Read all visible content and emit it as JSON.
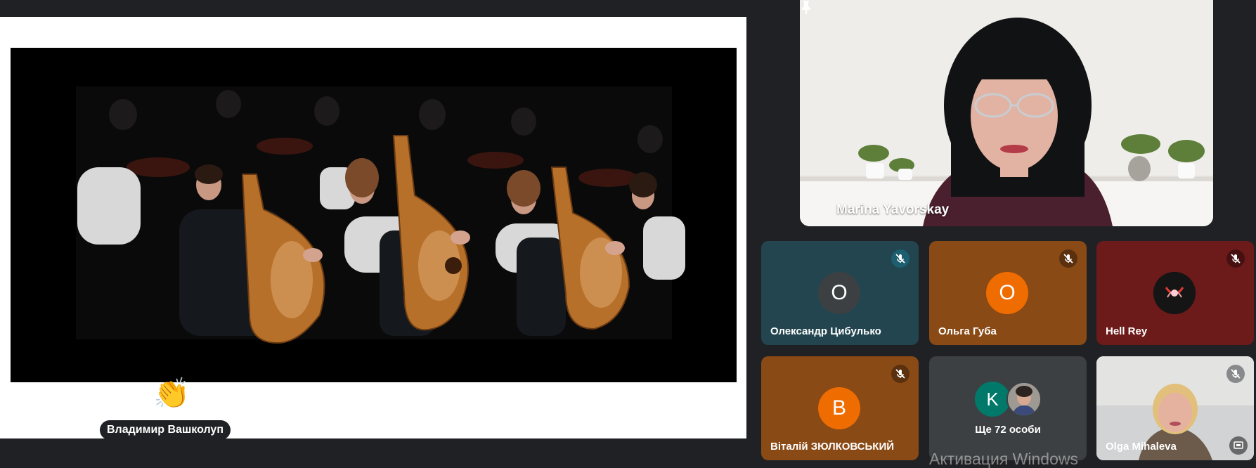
{
  "presentation": {
    "reaction": {
      "emoji": "👏",
      "name": "Владимир Вашколуп"
    }
  },
  "featured": {
    "name": "Marina Yavorskay",
    "pinned": true
  },
  "participants": [
    {
      "name": "Олександр Цибулько",
      "initial": "О",
      "bg": "#23454f",
      "avatar_bg": "#3c4043",
      "muted": true
    },
    {
      "name": "Ольга Губа",
      "initial": "О",
      "bg": "#8a4a16",
      "avatar_bg": "#ef6c00",
      "muted": true
    },
    {
      "name": "Hell Rey",
      "initial": "",
      "bg": "#6d1a1a",
      "avatar_bg": "#111111",
      "muted": true
    },
    {
      "name": "Віталій ЗЮЛКОВСЬКИЙ",
      "initial": "В",
      "bg": "#8a4a16",
      "avatar_bg": "#ef6c00",
      "muted": true
    },
    {
      "name": "Olga Mihaleva",
      "initial": "",
      "bg": "#cfcfd0",
      "muted": true
    }
  ],
  "more": {
    "initial": "K",
    "label": "Ще 72 особи"
  },
  "watermark": "Активация Windows",
  "colors": {
    "background": "#202124",
    "tile_dark": "#3c4043"
  },
  "icons": {
    "pin": "pin-icon",
    "mic_off": "mic-off-icon",
    "screen_share": "present-screen-icon"
  }
}
